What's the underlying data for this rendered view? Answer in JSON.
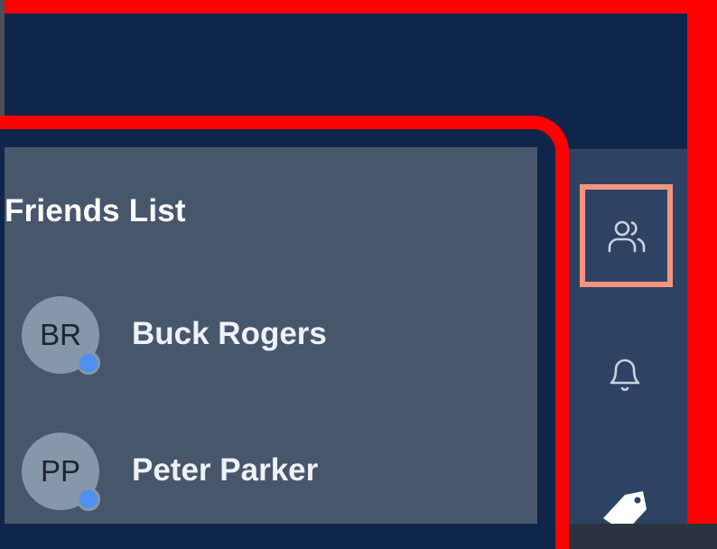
{
  "friends_panel": {
    "title": "Friends List",
    "friends": [
      {
        "initials": "BR",
        "name": "Buck Rogers",
        "online": true
      },
      {
        "initials": "PP",
        "name": "Peter Parker",
        "online": true
      }
    ]
  },
  "side_rail": {
    "items": [
      {
        "icon": "users-icon",
        "active": true
      },
      {
        "icon": "bell-icon",
        "active": false
      },
      {
        "icon": "tag-icon",
        "active": false
      }
    ]
  },
  "colors": {
    "highlight_border": "#ff0000",
    "active_outline": "#f2967b",
    "header": "#0f254a",
    "panel": "#48566b",
    "rail": "#2e4263",
    "presence": "#4f8ff0"
  }
}
